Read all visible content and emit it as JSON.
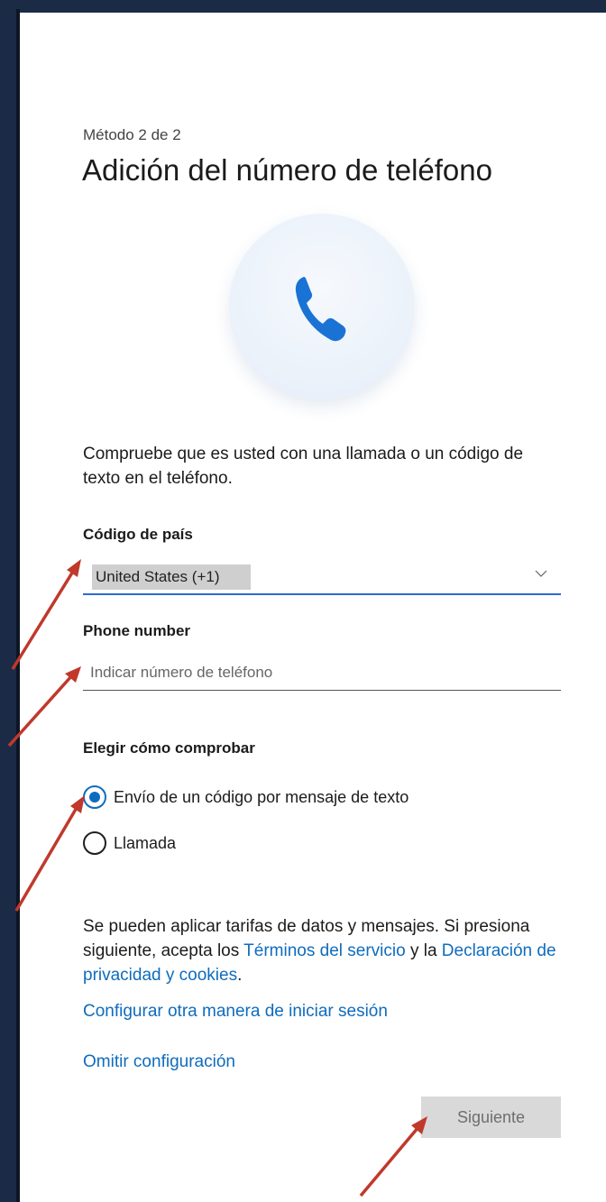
{
  "header": {
    "step_text": "Método 2 de 2",
    "title": "Adición del número de teléfono"
  },
  "illustration": {
    "icon": "phone-icon",
    "accent": "#0f6cbd"
  },
  "description": "Compruebe que es usted con una llamada o un código de texto en el teléfono.",
  "country": {
    "label": "Código de país",
    "selected": "United States (+1)"
  },
  "phone": {
    "label": "Phone number",
    "placeholder": "Indicar número de teléfono",
    "value": ""
  },
  "verify": {
    "label": "Elegir cómo comprobar",
    "options": [
      {
        "label": "Envío de un código por mensaje de texto",
        "checked": true
      },
      {
        "label": "Llamada",
        "checked": false
      }
    ]
  },
  "terms": {
    "text_1": "Se pueden aplicar tarifas de datos y mensajes. Si presiona siguiente, acepta los ",
    "link_terms": "Términos del servicio",
    "text_2": " y la ",
    "link_privacy": "Declaración de privacidad y cookies",
    "text_3": "."
  },
  "links": {
    "alternate": "Configurar otra manera de iniciar sesión",
    "skip": "Omitir configuración"
  },
  "buttons": {
    "next": "Siguiente"
  },
  "colors": {
    "link": "#0f6cbd",
    "annotation_arrow": "#c0392b",
    "window_border": "#1b2a45"
  }
}
